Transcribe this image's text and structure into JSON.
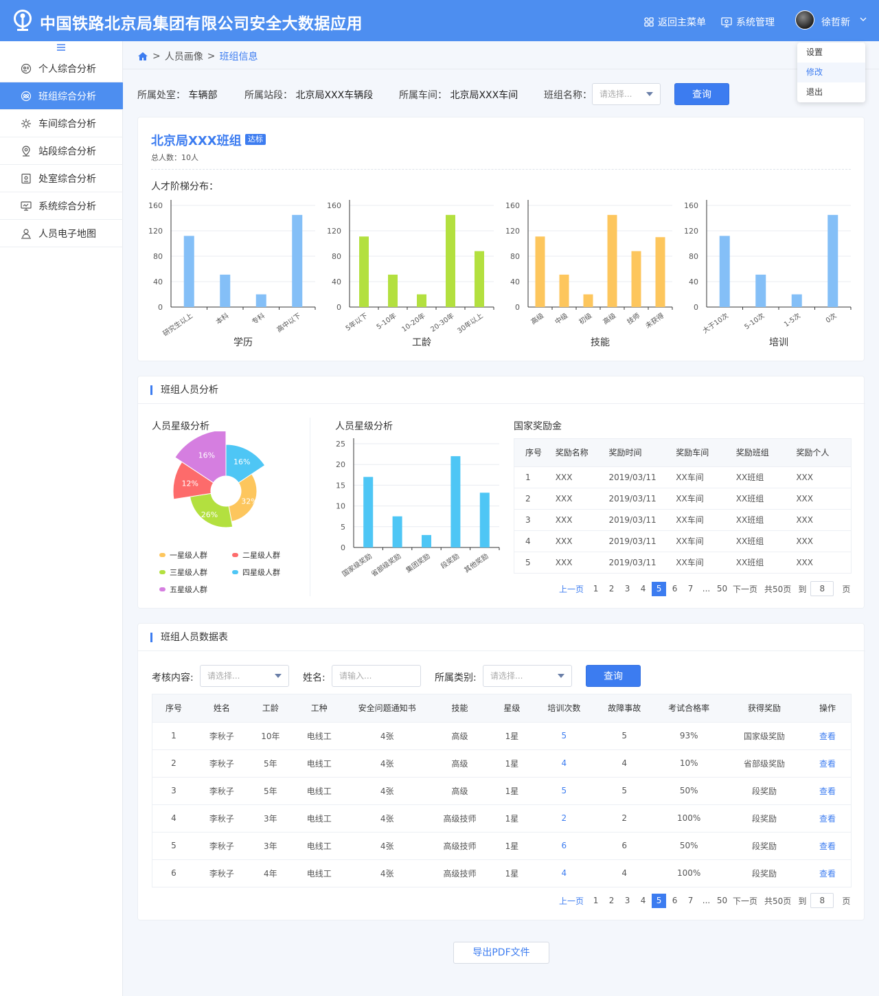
{
  "header": {
    "title": "中国铁路北京局集团有限公司安全大数据应用",
    "nav_back": "返回主菜单",
    "nav_system": "系统管理",
    "user_name": "徐哲新"
  },
  "user_menu": [
    "设置",
    "修改",
    "退出"
  ],
  "sidebar": {
    "items": [
      {
        "label": "个人综合分析",
        "icon": "person-analysis-icon"
      },
      {
        "label": "班组综合分析",
        "icon": "team-analysis-icon",
        "active": true
      },
      {
        "label": "车间综合分析",
        "icon": "workshop-icon"
      },
      {
        "label": "站段综合分析",
        "icon": "location-icon"
      },
      {
        "label": "处室综合分析",
        "icon": "office-icon"
      },
      {
        "label": "系统综合分析",
        "icon": "monitor-icon"
      },
      {
        "label": "人员电子地图",
        "icon": "map-icon"
      }
    ]
  },
  "breadcrumb": {
    "parent": "人员画像",
    "current": "班组信息"
  },
  "filters": {
    "dept_label": "所属处室：",
    "dept_value": "车辆部",
    "station_label": "所属站段：",
    "station_value": "北京局XXX车辆段",
    "workshop_label": "所属车间：",
    "workshop_value": "北京局XXX车间",
    "team_label": "班组名称：",
    "team_placeholder": "请选择...",
    "query_label": "查询"
  },
  "team": {
    "name": "北京局XXX班组",
    "badge": "达标",
    "total": "总人数：10人",
    "ladder_title": "人才阶梯分布："
  },
  "chart_data": [
    {
      "type": "bar",
      "title": "学历",
      "categories": [
        "研究生以上",
        "本科",
        "专科",
        "高中以下"
      ],
      "values": [
        112,
        51,
        20,
        145
      ],
      "yticks": [
        0,
        40,
        80,
        120,
        160
      ],
      "ylim": [
        0,
        160
      ],
      "color": "#84bff7"
    },
    {
      "type": "bar",
      "title": "工龄",
      "categories": [
        "5年以下",
        "5-10年",
        "10-20年",
        "20-30年",
        "30年以上"
      ],
      "values": [
        111,
        51,
        20,
        145,
        88
      ],
      "yticks": [
        0,
        40,
        80,
        120,
        160
      ],
      "ylim": [
        0,
        160
      ],
      "color": "#b3e03f"
    },
    {
      "type": "bar",
      "title": "技能",
      "categories": [
        "高级",
        "中级",
        "初级",
        "高级",
        "技师",
        "未获得"
      ],
      "values": [
        111,
        51,
        20,
        145,
        88,
        110
      ],
      "yticks": [
        0,
        40,
        80,
        120,
        160
      ],
      "ylim": [
        0,
        160
      ],
      "color": "#fdc65d"
    },
    {
      "type": "bar",
      "title": "培训",
      "categories": [
        "大于10次",
        "5-10次",
        "1-5次",
        "0次"
      ],
      "values": [
        112,
        51,
        20,
        145
      ],
      "yticks": [
        0,
        40,
        80,
        120,
        160
      ],
      "ylim": [
        0,
        160
      ],
      "color": "#84bff7"
    },
    {
      "type": "pie",
      "title": "人员星级分析",
      "series": [
        {
          "name": "一星级人群",
          "value": 32,
          "label": "32%",
          "color": "#fdc65d"
        },
        {
          "name": "三星级人群",
          "value": 26,
          "label": "26%",
          "color": "#b3e03f"
        },
        {
          "name": "二星级人群",
          "value": 12,
          "label": "12%",
          "color": "#fd6b6b"
        },
        {
          "name": "五星级人群",
          "value": 16,
          "label": "16%",
          "color": "#d57ee0"
        },
        {
          "name": "四星级人群",
          "value": 16,
          "label": "16%",
          "color": "#4ec6f5"
        }
      ]
    },
    {
      "type": "bar",
      "title": "人员星级分析",
      "categories": [
        "国家级奖励",
        "省部级奖励",
        "集团奖励",
        "段奖励",
        "其他奖励"
      ],
      "values": [
        17,
        7.5,
        3,
        22,
        13.2
      ],
      "yticks": [
        0,
        5,
        10,
        15,
        20,
        25
      ],
      "ylim": [
        0,
        25
      ],
      "color": "#4ec6f5"
    }
  ],
  "analysis": {
    "section_title": "班组人员分析",
    "pie_title": "人员星级分析",
    "bar_title": "人员星级分析",
    "award_title": "国家奖励金",
    "legend": [
      {
        "label": "一星级人群",
        "color": "#fdc65d"
      },
      {
        "label": "二星级人群",
        "color": "#fd6b6b"
      },
      {
        "label": "三星级人群",
        "color": "#b3e03f"
      },
      {
        "label": "四星级人群",
        "color": "#4ec6f5"
      },
      {
        "label": "五星级人群",
        "color": "#d57ee0"
      }
    ]
  },
  "award_table": {
    "headers": [
      "序号",
      "奖励名称",
      "奖励时间",
      "奖励车间",
      "奖励班组",
      "奖励个人"
    ],
    "rows": [
      [
        "1",
        "XXX",
        "2019/03/11",
        "XX车间",
        "XX班组",
        "XXX"
      ],
      [
        "2",
        "XXX",
        "2019/03/11",
        "XX车间",
        "XX班组",
        "XXX"
      ],
      [
        "3",
        "XXX",
        "2019/03/11",
        "XX车间",
        "XX班组",
        "XXX"
      ],
      [
        "4",
        "XXX",
        "2019/03/11",
        "XX车间",
        "XX班组",
        "XXX"
      ],
      [
        "5",
        "XXX",
        "2019/03/11",
        "XX车间",
        "XX班组",
        "XXX"
      ]
    ]
  },
  "pager": {
    "prev": "上一页",
    "pages": [
      "1",
      "2",
      "3",
      "4",
      "5",
      "6",
      "7",
      "...",
      "50"
    ],
    "current": "5",
    "next": "下一页",
    "total": "共50页",
    "goto": "到",
    "input": "8",
    "unit": "页"
  },
  "data_section": {
    "title": "班组人员数据表",
    "exam_label": "考核内容:",
    "exam_placeholder": "请选择...",
    "name_label": "姓名:",
    "name_placeholder": "请输入...",
    "category_label": "所属类别:",
    "category_placeholder": "请选择...",
    "query_label": "查询"
  },
  "staff_table": {
    "headers": [
      "序号",
      "姓名",
      "工龄",
      "工种",
      "安全问题通知书",
      "技能",
      "星级",
      "培训次数",
      "故障事故",
      "考试合格率",
      "获得奖励",
      "操作"
    ],
    "rows": [
      [
        "1",
        "李秋子",
        "10年",
        "电线工",
        "4张",
        "高级",
        "1星",
        "5",
        "5",
        "93%",
        "国家级奖励",
        "查看"
      ],
      [
        "2",
        "李秋子",
        "5年",
        "电线工",
        "4张",
        "高级",
        "1星",
        "4",
        "4",
        "10%",
        "省部级奖励",
        "查看"
      ],
      [
        "3",
        "李秋子",
        "5年",
        "电线工",
        "4张",
        "高级",
        "1星",
        "5",
        "5",
        "50%",
        "段奖励",
        "查看"
      ],
      [
        "4",
        "李秋子",
        "3年",
        "电线工",
        "4张",
        "高级技师",
        "1星",
        "2",
        "2",
        "100%",
        "段奖励",
        "查看"
      ],
      [
        "5",
        "李秋子",
        "3年",
        "电线工",
        "4张",
        "高级技师",
        "1星",
        "6",
        "6",
        "50%",
        "段奖励",
        "查看"
      ],
      [
        "6",
        "李秋子",
        "4年",
        "电线工",
        "4张",
        "高级技师",
        "1星",
        "4",
        "4",
        "100%",
        "段奖励",
        "查看"
      ]
    ]
  },
  "export_label": "导出PDF文件"
}
